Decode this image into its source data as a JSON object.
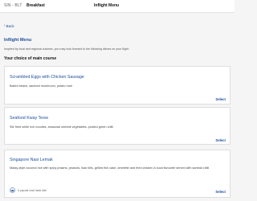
{
  "header": {
    "route": "SIN - BLT",
    "meal": "Breakfast",
    "title": "Inflight Menu"
  },
  "back_label": "Back",
  "page_title": "Inflight Menu",
  "intro": "Inspired by local and regional cuisines, you may look forward to the following dishes on your flight.",
  "section_title": "Your choice of main course",
  "dishes": [
    {
      "name": "Scrambled Eggs with Chicken Sausage",
      "description": "Baked beans, sauteed mushroom, potato rosti",
      "select_label": "Select"
    },
    {
      "name": "Seafood Kway Teow",
      "description": "Stir fried white rice noodles, seasonal oriental vegetables, pickled green chilli",
      "select_label": "Select"
    },
    {
      "name": "Singapore Nasi Lemak",
      "description": "Malay-style coconut rice with spicy prawns, peanuts, ikan bilis, grilled fish cake, omelette and fried chicken A local favourite served with sambal chilli",
      "tag": "A popular local hawk dish",
      "select_label": "Select"
    }
  ],
  "colors": {
    "accent": "#1b4e9b",
    "background": "#f5f5f5",
    "card": "#ffffff"
  }
}
